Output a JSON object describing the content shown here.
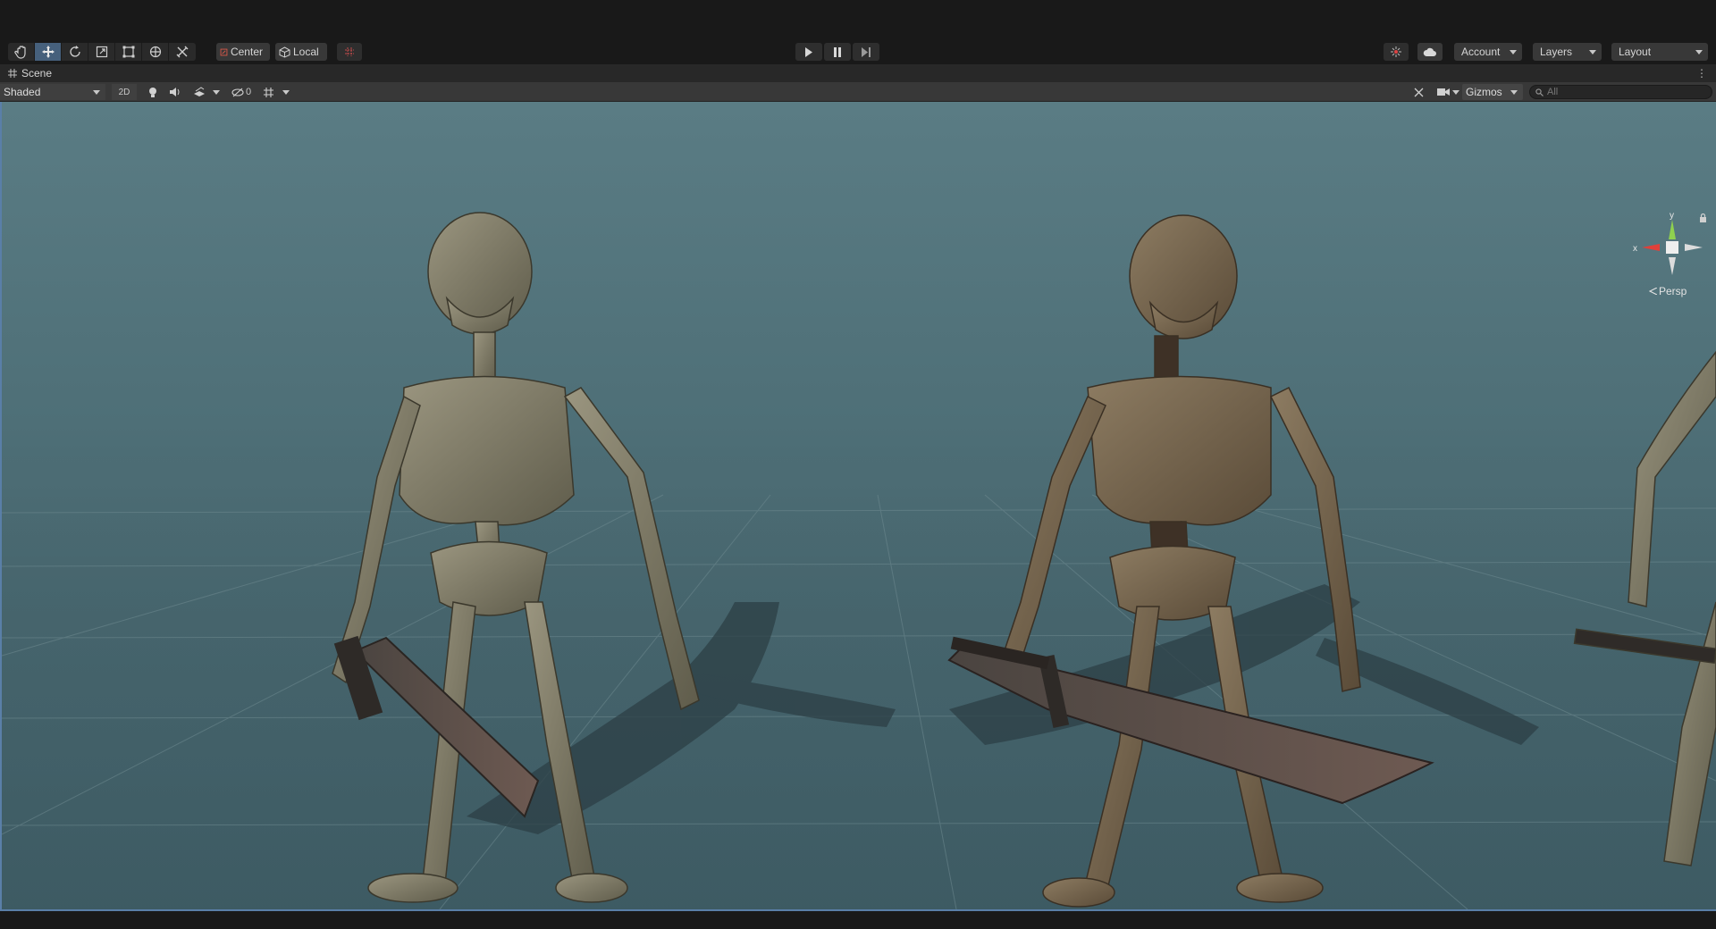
{
  "toolbar": {
    "tools": [
      "hand-tool",
      "move-tool",
      "rotate-tool",
      "scale-tool",
      "rect-tool",
      "transform-tool",
      "custom-tool"
    ],
    "active_tool": "move-tool",
    "pivot_mode": "Center",
    "pivot_space": "Local",
    "playmode": [
      "play",
      "pause",
      "step"
    ],
    "account_label": "Account",
    "layers_label": "Layers",
    "layout_label": "Layout"
  },
  "tab": {
    "label": "Scene"
  },
  "scene_toolbar": {
    "draw_mode": "Shaded",
    "mode_2d": "2D",
    "hidden_count": "0",
    "gizmos_label": "Gizmos",
    "search_placeholder": "All"
  },
  "viewport": {
    "gizmo_axes": {
      "x": "x",
      "y": "y"
    },
    "projection_label": "Persp",
    "colors": {
      "selection": "#5a7fa8",
      "x_axis": "#e0403a",
      "y_axis": "#8fd14f",
      "z_axis": "#5f8fe0"
    }
  }
}
